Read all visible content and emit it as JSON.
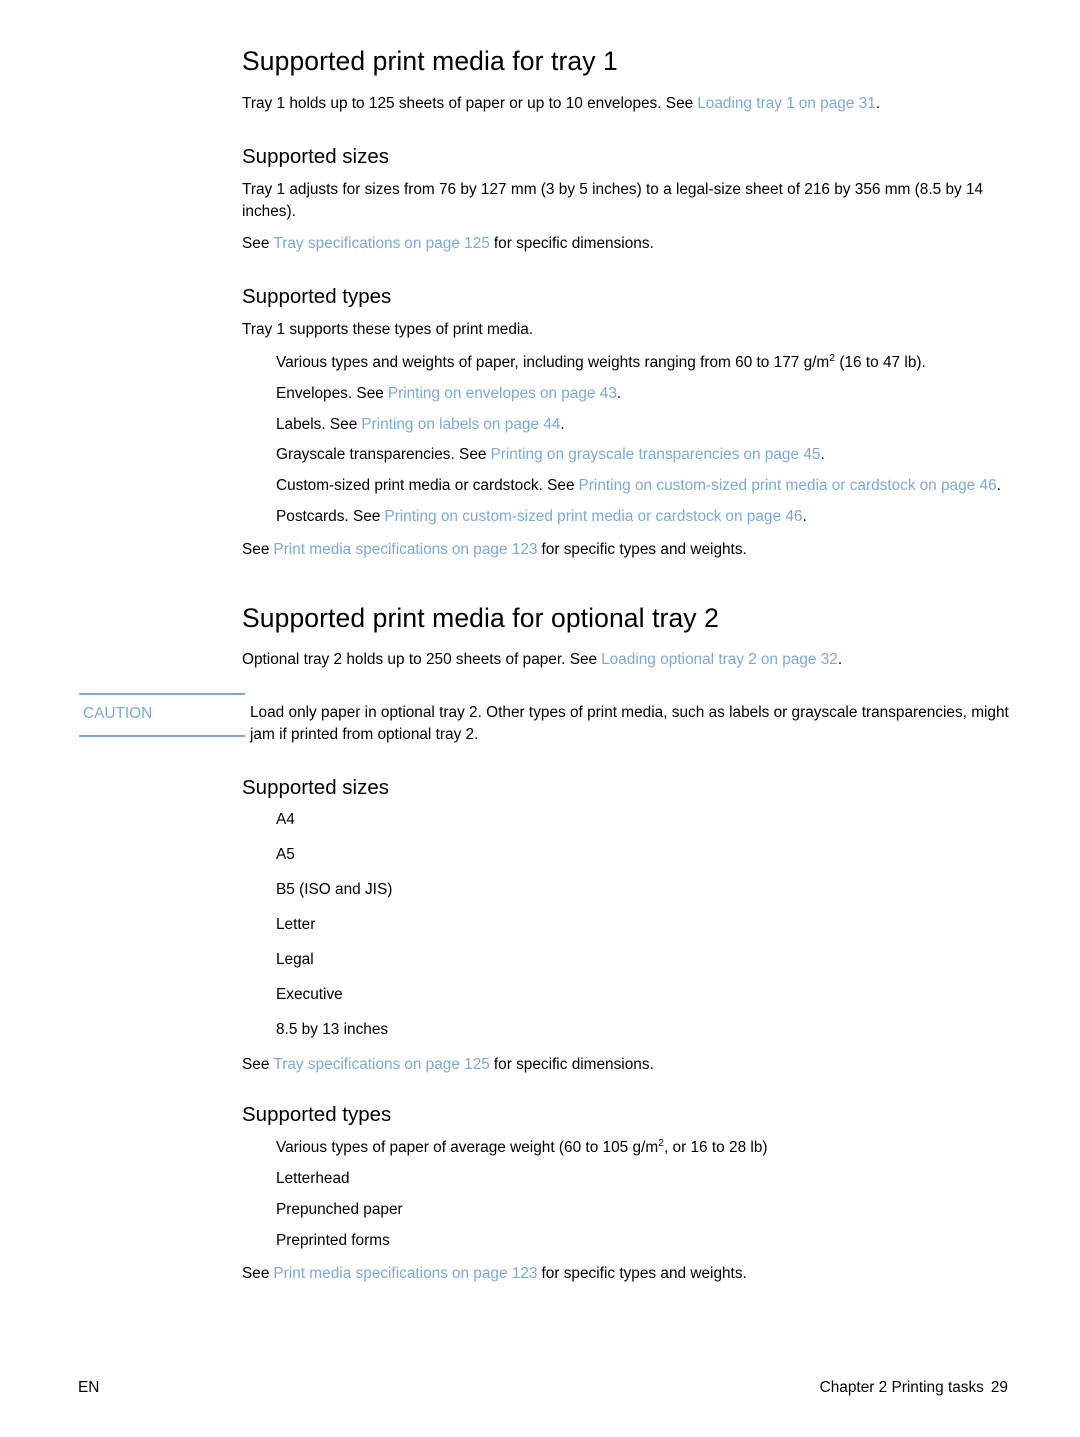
{
  "document": {
    "sections": [
      {
        "id": "tray1",
        "heading": "Supported print media for tray 1",
        "intro_prefix": "Tray 1 holds up to 125 sheets of paper or up to 10 envelopes. See",
        "intro_link_title": "Loading tray 1",
        "intro_link_page": "on page 31",
        "intro_suffix": ".",
        "sizes": {
          "heading": "Supported sizes",
          "paragraph": "Tray 1 adjusts for sizes from 76 by 127 mm (3 by 5 inches) to a legal-size sheet of 216 by 356 mm (8.5 by 14 inches).",
          "see_prefix": "See",
          "see_link_title": "Tray specifications",
          "see_link_page": "on page 125",
          "see_suffix": "for specific dimensions."
        },
        "types": {
          "heading": "Supported types",
          "paragraph": "Tray 1 supports these types of print media.",
          "items": [
            {
              "text_before": "Various types and weights of paper, including weights ranging from 60 to 177 g/m",
              "superscript": "2",
              "text_after": " (16 to 47 lb)."
            },
            {
              "text_before": "Envelopes. See",
              "link_title": "Printing on envelopes",
              "link_page": "on page 43",
              "text_after": "."
            },
            {
              "text_before": "Labels. See",
              "link_title": "Printing on labels",
              "link_page": "on page 44",
              "text_after": "."
            },
            {
              "text_before": "Grayscale transparencies. See",
              "link_title": "Printing on grayscale transparencies",
              "link_page": "on page 45",
              "text_after": "."
            },
            {
              "text_before": "Custom-sized print media or cardstock. See",
              "link_title": "Printing on custom-sized print media or cardstock",
              "link_page": "on page 46",
              "text_after": "."
            },
            {
              "text_before": "Postcards. See",
              "link_title": "Printing on custom-sized print media or cardstock",
              "link_page": "on page 46",
              "text_after": "."
            }
          ],
          "see_prefix": "See",
          "see_link_title": "Print media specifications",
          "see_link_page": "on page 123",
          "see_suffix": "for specific types and weights."
        }
      },
      {
        "id": "tray2",
        "heading": "Supported print media for optional tray 2",
        "intro_prefix": "Optional tray 2 holds up to 250 sheets of paper. See",
        "intro_link_title": "Loading optional tray 2",
        "intro_link_page": "on page 32",
        "intro_suffix": ".",
        "caution": {
          "label": "CAUTION",
          "text": "Load only paper in optional tray 2. Other types of print media, such as labels or grayscale transparencies, might jam if printed from optional tray 2."
        },
        "sizes": {
          "heading": "Supported sizes",
          "items": [
            "A4",
            "A5",
            "B5 (ISO and JIS)",
            "Letter",
            "Legal",
            "Executive",
            "8.5 by 13 inches"
          ],
          "see_prefix": "See",
          "see_link_title": "Tray specifications",
          "see_link_page": "on page 125",
          "see_suffix": "for specific dimensions."
        },
        "types": {
          "heading": "Supported types",
          "items": [
            {
              "text_before": "Various types of paper of average weight (60 to 105 g/m",
              "superscript": "2",
              "text_after": ", or 16 to 28 lb)"
            },
            {
              "text_before": "Letterhead"
            },
            {
              "text_before": "Prepunched paper"
            },
            {
              "text_before": "Preprinted forms"
            }
          ],
          "see_prefix": "See",
          "see_link_title": "Print media specifications",
          "see_link_page": "on page 123",
          "see_suffix": "for specific types and weights."
        }
      }
    ]
  },
  "footer": {
    "language": "EN",
    "chapter": "Chapter 2 Printing tasks",
    "page_number": "29"
  },
  "colors": {
    "link": "#7aa9d8",
    "text": "#000000",
    "background": "#ffffff"
  }
}
